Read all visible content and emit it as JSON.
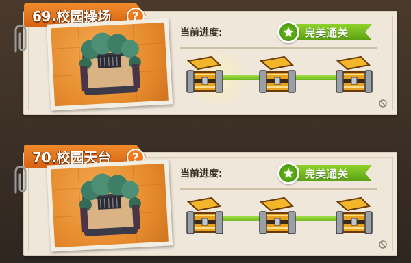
{
  "levels": [
    {
      "title": "69.校园操场",
      "help": "?",
      "progress_label": "当前进度:",
      "perfect_label": "完美通关",
      "chests": [
        "chest-1",
        "chest-2",
        "chest-3"
      ]
    },
    {
      "title": "70.校园天台",
      "help": "?",
      "progress_label": "当前进度:",
      "perfect_label": "完美通关",
      "chests": [
        "chest-1",
        "chest-2",
        "chest-3"
      ]
    }
  ],
  "colors": {
    "tab_orange": "#e8731c",
    "perfect_green": "#5aa014",
    "track_green": "#8ed236",
    "card_bg": "#efe7da"
  }
}
